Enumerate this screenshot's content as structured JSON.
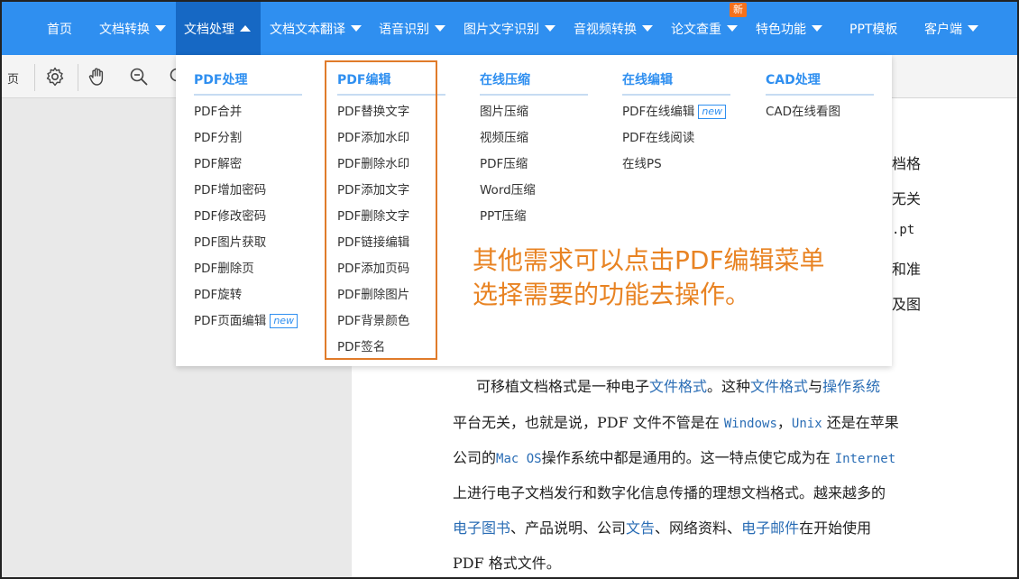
{
  "nav": {
    "items": [
      {
        "label": "首页",
        "caret": false
      },
      {
        "label": "文档转换",
        "caret": true
      },
      {
        "label": "文档处理",
        "caret": true
      },
      {
        "label": "文档文本翻译",
        "caret": true
      },
      {
        "label": "语音识别",
        "caret": true
      },
      {
        "label": "图片文字识别",
        "caret": true
      },
      {
        "label": "音视频转换",
        "caret": true
      },
      {
        "label": "论文查重",
        "caret": true
      },
      {
        "label": "特色功能",
        "caret": true
      },
      {
        "label": "PPT模板",
        "caret": false
      },
      {
        "label": "客户端",
        "caret": true
      }
    ],
    "badge": "新",
    "active_index": 2
  },
  "toolbar": {
    "page_label": "页",
    "icons": [
      "gear-icon",
      "hand-icon",
      "zoom-out-icon",
      "zoom-in-icon"
    ]
  },
  "dropdown": {
    "new_tag": "new",
    "columns": [
      {
        "heading": "PDF处理",
        "items": [
          "PDF合并",
          "PDF分割",
          "PDF解密",
          "PDF增加密码",
          "PDF修改密码",
          "PDF图片获取",
          "PDF删除页",
          "PDF旋转",
          "PDF页面编辑"
        ]
      },
      {
        "heading": "PDF编辑",
        "items": [
          "PDF替换文字",
          "PDF添加水印",
          "PDF删除水印",
          "PDF添加文字",
          "PDF删除文字",
          "PDF链接编辑",
          "PDF添加页码",
          "PDF删除图片",
          "PDF背景颜色",
          "PDF签名"
        ]
      },
      {
        "heading": "在线压缩",
        "items": [
          "图片压缩",
          "视频压缩",
          "PDF压缩",
          "Word压缩",
          "PPT压缩"
        ]
      },
      {
        "heading": "在线编辑",
        "items": [
          "PDF在线编辑",
          "PDF在线阅读",
          "在线PS"
        ]
      },
      {
        "heading": "CAD处理",
        "items": [
          "CAD在线看图"
        ]
      }
    ]
  },
  "annotation": {
    "line1": "其他需求可以点击PDF编辑菜单",
    "line2": "选择需要的功能去操作。"
  },
  "doc": {
    "right_fragments": [
      "档格",
      "无关",
      ".pt",
      "和准",
      "及图"
    ],
    "p_line1_a": "可移植文档格式是一种电子",
    "p_line1_link1": "文件格式",
    "p_line1_b": "。这种",
    "p_line1_link2": "文件格式",
    "p_line1_c": "与",
    "p_line1_link3": "操作系统",
    "p_line2_a": "平台无关，也就是说，PDF 文件不管是在 ",
    "p_line2_link1": "Windows",
    "p_line2_b": "，",
    "p_line2_link2": "Unix",
    "p_line2_c": " 还是在苹果",
    "p_line3_a": "公司的",
    "p_line3_link1": "Mac OS",
    "p_line3_b": "操作系统中都是通用的。这一特点使它成为在 ",
    "p_line3_link2": "Internet",
    "p_line4": "上进行电子文档发行和数字化信息传播的理想文档格式。越来越多的",
    "p_line5_link1": "电子图书",
    "p_line5_a": "、产品说明、公司",
    "p_line5_link2": "文告",
    "p_line5_b": "、网络资料、",
    "p_line5_link3": "电子邮件",
    "p_line5_c": "在开始使用",
    "p_line6": "PDF 格式文件。"
  },
  "colors": {
    "nav_bg": "#2f8ff0",
    "nav_active": "#1668c4",
    "accent": "#2f8ff0",
    "annotation": "#e88323",
    "badge": "#f5711b"
  }
}
